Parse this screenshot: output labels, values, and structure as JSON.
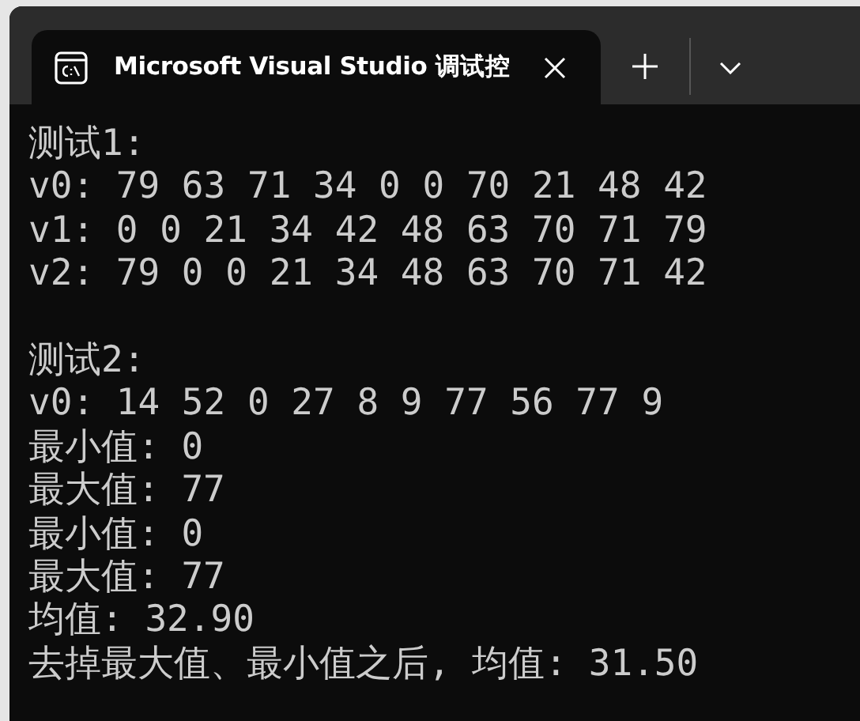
{
  "tabs": [
    {
      "title": "Microsoft Visual Studio 调试控",
      "selected": true
    }
  ],
  "console": {
    "sections": [
      {
        "lines": [
          "测试1:",
          "v0: 79 63 71 34 0 0 70 21 48 42",
          "v1: 0 0 21 34 42 48 63 70 71 79",
          "v2: 79 0 0 21 34 48 63 70 71 42"
        ]
      },
      {
        "lines": [
          "测试2:",
          "v0: 14 52 0 27 8 9 77 56 77 9",
          "最小值: 0",
          "最大值: 77",
          "最小值: 0",
          "最大值: 77",
          "均值: 32.90",
          "去掉最大值、最小值之后, 均值: 31.50"
        ]
      }
    ]
  }
}
